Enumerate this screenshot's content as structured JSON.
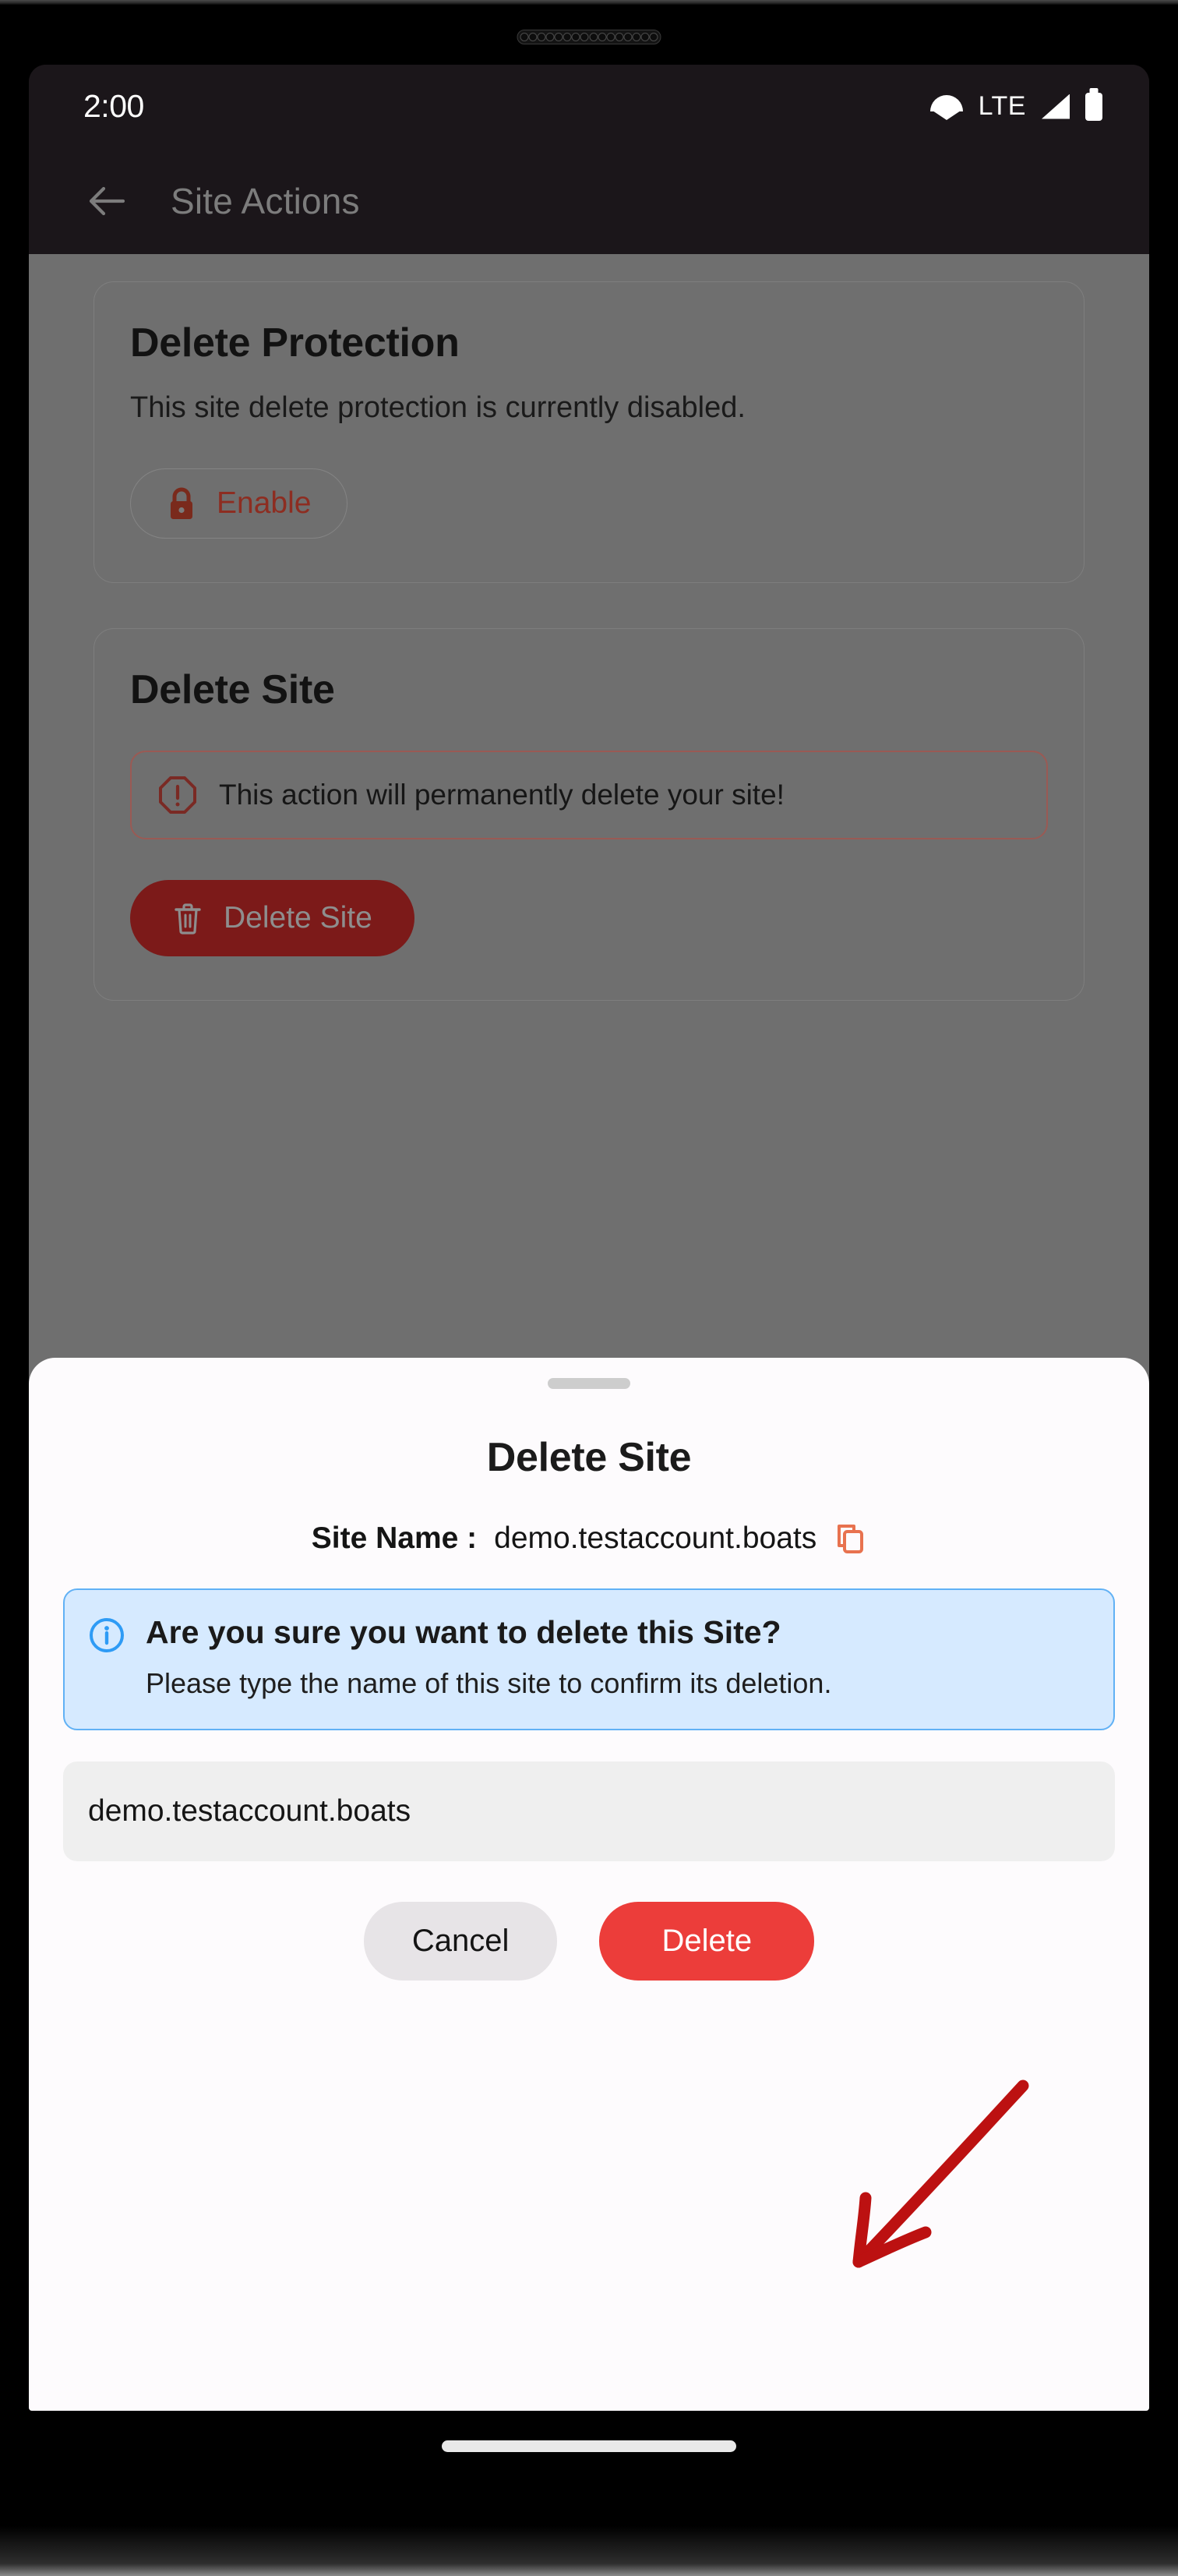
{
  "status_bar": {
    "time": "2:00",
    "network_label": "LTE",
    "icons": [
      "wifi-icon",
      "signal-icon",
      "battery-icon"
    ]
  },
  "app_bar": {
    "back_icon": "back-arrow-icon",
    "title": "Site Actions"
  },
  "page": {
    "delete_protection_card": {
      "title": "Delete Protection",
      "description": "This site delete protection is currently disabled.",
      "enable_button": {
        "label": "Enable",
        "icon": "lock-icon"
      }
    },
    "delete_site_card": {
      "title": "Delete Site",
      "warning": {
        "icon": "octagon-alert-icon",
        "text": "This action will permanently delete your site!"
      },
      "delete_button": {
        "label": "Delete Site",
        "icon": "trash-icon"
      }
    }
  },
  "bottom_sheet": {
    "handle": "drag-handle",
    "title": "Delete Site",
    "site_name_label": "Site Name :",
    "site_name_value": "demo.testaccount.boats",
    "copy_icon": "copy-icon",
    "alert": {
      "icon": "info-circle-icon",
      "heading": "Are you sure you want to delete this Site?",
      "body": "Please type the name of this site to confirm its deletion."
    },
    "confirm_input": {
      "value": "demo.testaccount.boats",
      "placeholder": "demo.testaccount.boats"
    },
    "cancel_button": "Cancel",
    "delete_button": "Delete"
  },
  "annotation": {
    "type": "arrow",
    "points_to": "delete-confirm-button",
    "color": "#bc1111"
  },
  "colors": {
    "app_bar_bg": "#1b161a",
    "scrim": "#6f6f6f",
    "sheet_bg": "#fdfbfd",
    "danger_red": "#ec3d3a",
    "danger_red_dim": "#7c1a19",
    "brick_red": "#8d2d21",
    "info_blue": "#2e9bf5",
    "info_blue_bg": "#d6eaff",
    "copy_orange": "#e8724f",
    "input_bg": "#efefef",
    "cancel_bg": "#e7e4e7"
  },
  "nav_bar": {
    "home_indicator": "home-indicator"
  }
}
